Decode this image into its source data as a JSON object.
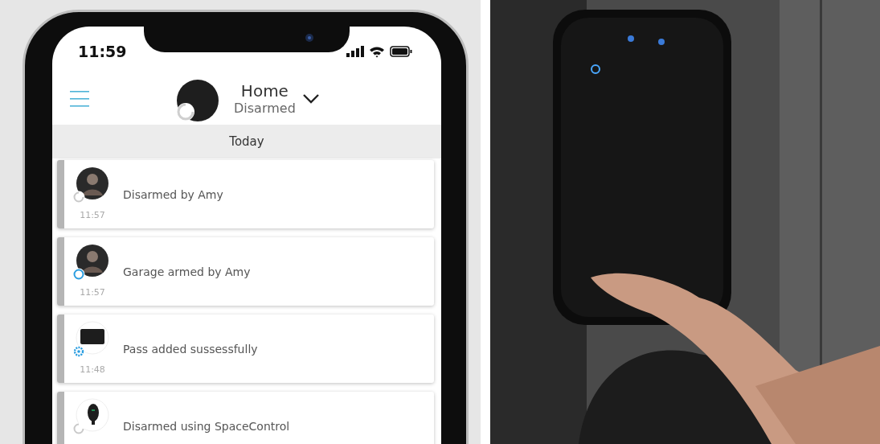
{
  "phone": {
    "status_bar": {
      "time": "11:59"
    },
    "header": {
      "title": "Home",
      "status": "Disarmed"
    },
    "section": "Today",
    "events": [
      {
        "avatar": {
          "kind": "person"
        },
        "badge": {
          "kind": "disarmed"
        },
        "text": "Disarmed by Amy",
        "time": "11:57"
      },
      {
        "avatar": {
          "kind": "person"
        },
        "badge": {
          "kind": "armed"
        },
        "text": "Garage armed by Amy",
        "time": "11:57"
      },
      {
        "avatar": {
          "kind": "card"
        },
        "badge": {
          "kind": "added"
        },
        "text": "Pass added sussessfully",
        "time": "11:48"
      },
      {
        "avatar": {
          "kind": "fob"
        },
        "badge": {
          "kind": "disarmed"
        },
        "text": "Disarmed using SpaceControl"
      }
    ]
  }
}
